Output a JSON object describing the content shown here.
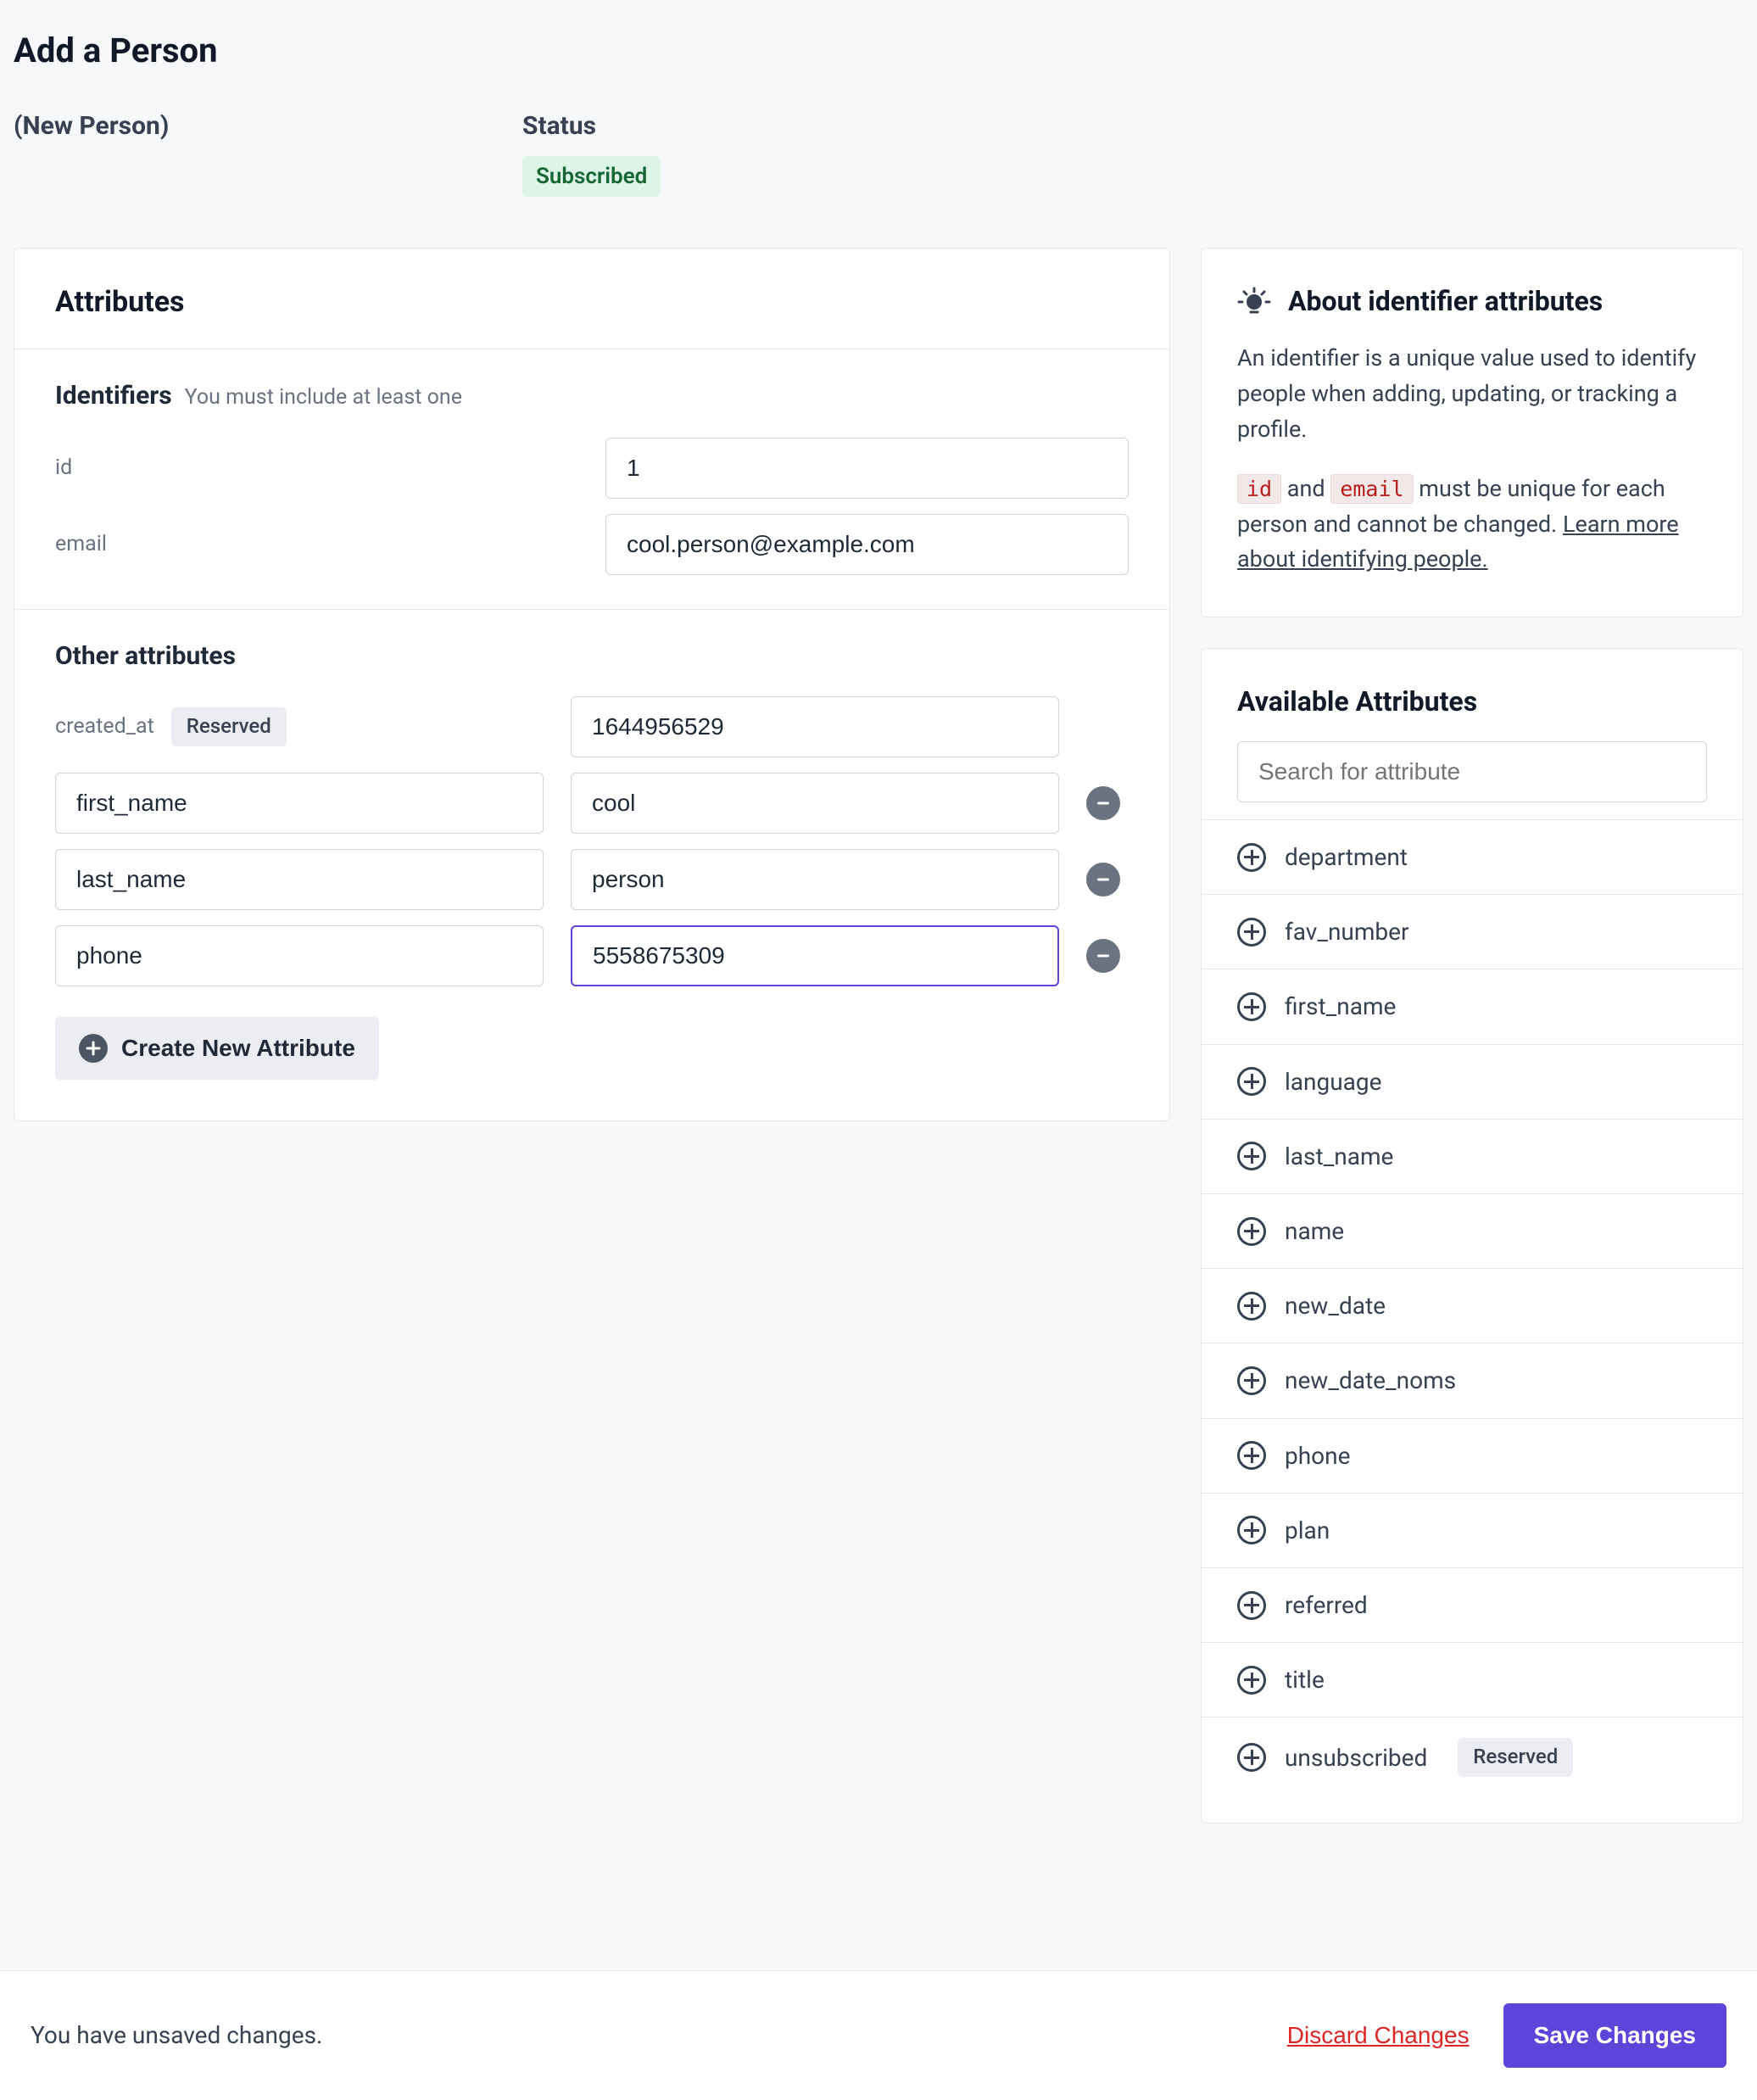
{
  "page_title": "Add a Person",
  "meta": {
    "new_person_label": "(New Person)",
    "status_label": "Status",
    "status_value": "Subscribed"
  },
  "attributes_card": {
    "title": "Attributes",
    "identifiers_label": "Identifiers",
    "identifiers_hint": "You must include at least one",
    "id_label": "id",
    "id_value": "1",
    "email_label": "email",
    "email_value": "cool.person@example.com",
    "other_label": "Other attributes",
    "created_at_label": "created_at",
    "reserved_badge": "Reserved",
    "created_at_value": "1644956529",
    "rows": [
      {
        "key": "first_name",
        "value": "cool"
      },
      {
        "key": "last_name",
        "value": "person"
      },
      {
        "key": "phone",
        "value": "5558675309"
      }
    ],
    "create_new_label": "Create New Attribute"
  },
  "about": {
    "title": "About identifier attributes",
    "desc": "An identifier is a unique value used to identify people when adding, updating, or tracking a profile.",
    "code_id": "id",
    "mid1": " and ",
    "code_email": "email",
    "mid2": " must be unique for each person and cannot be changed. ",
    "link": "Learn more about identifying people."
  },
  "available": {
    "title": "Available Attributes",
    "search_placeholder": "Search for attribute",
    "reserved_badge": "Reserved",
    "items": [
      {
        "name": "department",
        "reserved": false
      },
      {
        "name": "fav_number",
        "reserved": false
      },
      {
        "name": "first_name",
        "reserved": false
      },
      {
        "name": "language",
        "reserved": false
      },
      {
        "name": "last_name",
        "reserved": false
      },
      {
        "name": "name",
        "reserved": false
      },
      {
        "name": "new_date",
        "reserved": false
      },
      {
        "name": "new_date_noms",
        "reserved": false
      },
      {
        "name": "phone",
        "reserved": false
      },
      {
        "name": "plan",
        "reserved": false
      },
      {
        "name": "referred",
        "reserved": false
      },
      {
        "name": "title",
        "reserved": false
      },
      {
        "name": "unsubscribed",
        "reserved": true
      }
    ]
  },
  "footer": {
    "unsaved": "You have unsaved changes.",
    "discard": "Discard Changes",
    "save": "Save Changes"
  },
  "colors": {
    "accent": "#5b46d9",
    "danger": "#dc2626",
    "status_bg": "#dcf5e7",
    "status_fg": "#166534"
  }
}
